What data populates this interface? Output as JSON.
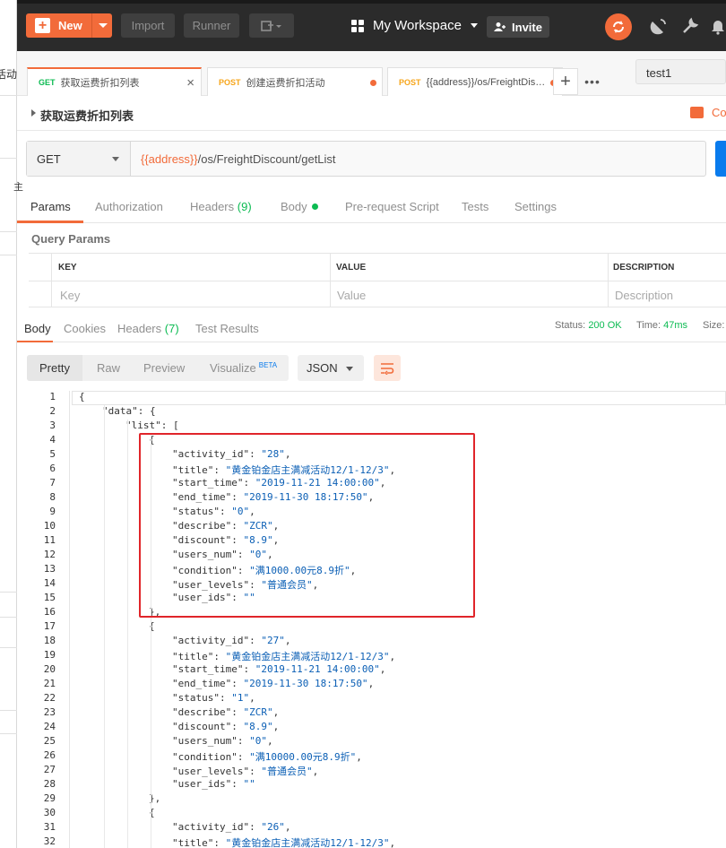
{
  "left_panel": {
    "partial_text": "活动",
    "mark": "主"
  },
  "header": {
    "new_label": "New",
    "import_label": "Import",
    "runner_label": "Runner",
    "workspace_label": "My Workspace",
    "invite_label": "Invite"
  },
  "tabs": [
    {
      "method": "GET",
      "name": "获取运费折扣列表",
      "active": true
    },
    {
      "method": "POST",
      "name": "创建运费折扣活动",
      "active": false
    },
    {
      "method": "POST",
      "name": "{{address}}/os/FreightDis…",
      "active": false
    }
  ],
  "environment": "test1",
  "request": {
    "name": "获取运费折扣列表",
    "comments_label": "Co",
    "method": "GET",
    "url_var": "{{address}}",
    "url_path": "/os/FreightDiscount/getList"
  },
  "request_tabs": {
    "params": "Params",
    "authorization": "Authorization",
    "headers": "Headers",
    "headers_count": "(9)",
    "body": "Body",
    "prerequest": "Pre-request Script",
    "tests": "Tests",
    "settings": "Settings"
  },
  "query_params": {
    "title": "Query Params",
    "col_key": "KEY",
    "col_value": "VALUE",
    "col_description": "DESCRIPTION",
    "key_placeholder": "Key",
    "value_placeholder": "Value",
    "description_placeholder": "Description"
  },
  "response_tabs": {
    "body": "Body",
    "cookies": "Cookies",
    "headers": "Headers",
    "headers_count": "(7)",
    "test_results": "Test Results"
  },
  "response_status": {
    "status_label": "Status:",
    "status_value": "200 OK",
    "time_label": "Time:",
    "time_value": "47ms",
    "size_label": "Size:"
  },
  "view_tabs": {
    "pretty": "Pretty",
    "raw": "Raw",
    "preview": "Preview",
    "visualize": "Visualize",
    "beta": "BETA",
    "format": "JSON"
  },
  "code_lines": [
    {
      "n": "1",
      "indent": 0,
      "parts": [
        [
          "k",
          "{"
        ]
      ]
    },
    {
      "n": "2",
      "indent": 1,
      "parts": [
        [
          "k",
          "\"data\": {"
        ]
      ]
    },
    {
      "n": "3",
      "indent": 2,
      "parts": [
        [
          "k",
          "\"list\": ["
        ]
      ]
    },
    {
      "n": "4",
      "indent": 3,
      "parts": [
        [
          "k",
          "{"
        ]
      ]
    },
    {
      "n": "5",
      "indent": 4,
      "parts": [
        [
          "k",
          "\"activity_id\": "
        ],
        [
          "s",
          "\"28\""
        ],
        [
          "k",
          ","
        ]
      ]
    },
    {
      "n": "6",
      "indent": 4,
      "parts": [
        [
          "k",
          "\"title\": "
        ],
        [
          "s",
          "\"黄金铂金店主满减活动12/1-12/3\""
        ],
        [
          "k",
          ","
        ]
      ]
    },
    {
      "n": "7",
      "indent": 4,
      "parts": [
        [
          "k",
          "\"start_time\": "
        ],
        [
          "s",
          "\"2019-11-21 14:00:00\""
        ],
        [
          "k",
          ","
        ]
      ]
    },
    {
      "n": "8",
      "indent": 4,
      "parts": [
        [
          "k",
          "\"end_time\": "
        ],
        [
          "s",
          "\"2019-11-30 18:17:50\""
        ],
        [
          "k",
          ","
        ]
      ]
    },
    {
      "n": "9",
      "indent": 4,
      "parts": [
        [
          "k",
          "\"status\": "
        ],
        [
          "s",
          "\"0\""
        ],
        [
          "k",
          ","
        ]
      ]
    },
    {
      "n": "10",
      "indent": 4,
      "parts": [
        [
          "k",
          "\"describe\": "
        ],
        [
          "s",
          "\"ZCR\""
        ],
        [
          "k",
          ","
        ]
      ]
    },
    {
      "n": "11",
      "indent": 4,
      "parts": [
        [
          "k",
          "\"discount\": "
        ],
        [
          "s",
          "\"8.9\""
        ],
        [
          "k",
          ","
        ]
      ]
    },
    {
      "n": "12",
      "indent": 4,
      "parts": [
        [
          "k",
          "\"users_num\": "
        ],
        [
          "s",
          "\"0\""
        ],
        [
          "k",
          ","
        ]
      ]
    },
    {
      "n": "13",
      "indent": 4,
      "parts": [
        [
          "k",
          "\"condition\": "
        ],
        [
          "s",
          "\"满1000.00元8.9折\""
        ],
        [
          "k",
          ","
        ]
      ]
    },
    {
      "n": "14",
      "indent": 4,
      "parts": [
        [
          "k",
          "\"user_levels\": "
        ],
        [
          "s",
          "\"普通会员\""
        ],
        [
          "k",
          ","
        ]
      ]
    },
    {
      "n": "15",
      "indent": 4,
      "parts": [
        [
          "k",
          "\"user_ids\": "
        ],
        [
          "s",
          "\"\""
        ]
      ]
    },
    {
      "n": "16",
      "indent": 3,
      "parts": [
        [
          "k",
          "},"
        ]
      ]
    },
    {
      "n": "17",
      "indent": 3,
      "parts": [
        [
          "k",
          "{"
        ]
      ]
    },
    {
      "n": "18",
      "indent": 4,
      "parts": [
        [
          "k",
          "\"activity_id\": "
        ],
        [
          "s",
          "\"27\""
        ],
        [
          "k",
          ","
        ]
      ]
    },
    {
      "n": "19",
      "indent": 4,
      "parts": [
        [
          "k",
          "\"title\": "
        ],
        [
          "s",
          "\"黄金铂金店主满减活动12/1-12/3\""
        ],
        [
          "k",
          ","
        ]
      ]
    },
    {
      "n": "20",
      "indent": 4,
      "parts": [
        [
          "k",
          "\"start_time\": "
        ],
        [
          "s",
          "\"2019-11-21 14:00:00\""
        ],
        [
          "k",
          ","
        ]
      ]
    },
    {
      "n": "21",
      "indent": 4,
      "parts": [
        [
          "k",
          "\"end_time\": "
        ],
        [
          "s",
          "\"2019-11-30 18:17:50\""
        ],
        [
          "k",
          ","
        ]
      ]
    },
    {
      "n": "22",
      "indent": 4,
      "parts": [
        [
          "k",
          "\"status\": "
        ],
        [
          "s",
          "\"1\""
        ],
        [
          "k",
          ","
        ]
      ]
    },
    {
      "n": "23",
      "indent": 4,
      "parts": [
        [
          "k",
          "\"describe\": "
        ],
        [
          "s",
          "\"ZCR\""
        ],
        [
          "k",
          ","
        ]
      ]
    },
    {
      "n": "24",
      "indent": 4,
      "parts": [
        [
          "k",
          "\"discount\": "
        ],
        [
          "s",
          "\"8.9\""
        ],
        [
          "k",
          ","
        ]
      ]
    },
    {
      "n": "25",
      "indent": 4,
      "parts": [
        [
          "k",
          "\"users_num\": "
        ],
        [
          "s",
          "\"0\""
        ],
        [
          "k",
          ","
        ]
      ]
    },
    {
      "n": "26",
      "indent": 4,
      "parts": [
        [
          "k",
          "\"condition\": "
        ],
        [
          "s",
          "\"满10000.00元8.9折\""
        ],
        [
          "k",
          ","
        ]
      ]
    },
    {
      "n": "27",
      "indent": 4,
      "parts": [
        [
          "k",
          "\"user_levels\": "
        ],
        [
          "s",
          "\"普通会员\""
        ],
        [
          "k",
          ","
        ]
      ]
    },
    {
      "n": "28",
      "indent": 4,
      "parts": [
        [
          "k",
          "\"user_ids\": "
        ],
        [
          "s",
          "\"\""
        ]
      ]
    },
    {
      "n": "29",
      "indent": 3,
      "parts": [
        [
          "k",
          "},"
        ]
      ]
    },
    {
      "n": "30",
      "indent": 3,
      "parts": [
        [
          "k",
          "{"
        ]
      ]
    },
    {
      "n": "31",
      "indent": 4,
      "parts": [
        [
          "k",
          "\"activity_id\": "
        ],
        [
          "s",
          "\"26\""
        ],
        [
          "k",
          ","
        ]
      ]
    },
    {
      "n": "32",
      "indent": 4,
      "parts": [
        [
          "k",
          "\"title\": "
        ],
        [
          "s",
          "\"黄金铂金店主满减活动12/1-12/3\""
        ],
        [
          "k",
          ","
        ]
      ]
    }
  ],
  "colors": {
    "accent": "#f26b3a",
    "success": "#0cbb52",
    "string": "#0b5fb5",
    "highlight_box": "#e0252a"
  }
}
